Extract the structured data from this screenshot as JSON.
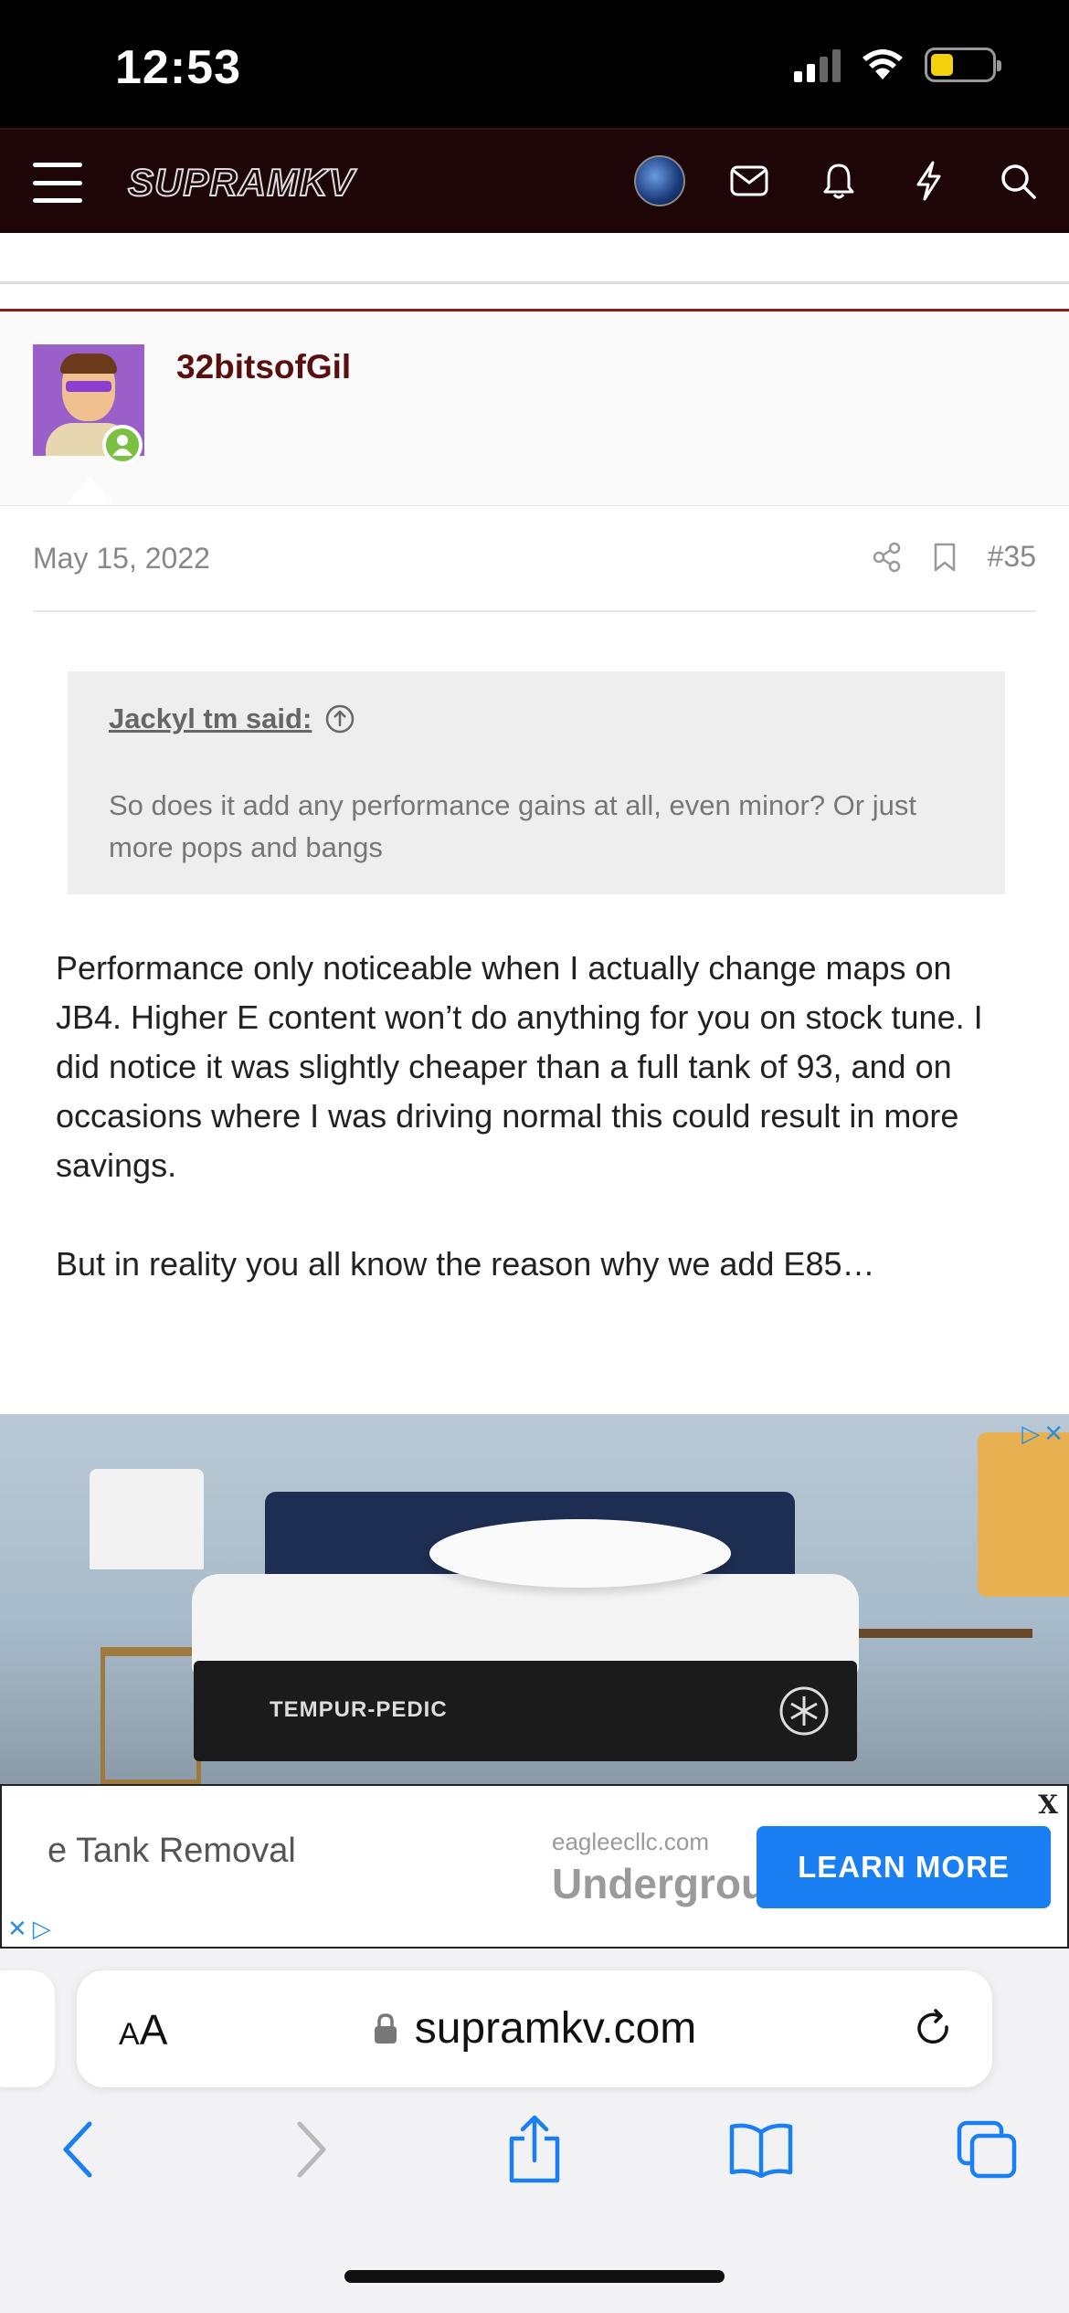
{
  "status_bar": {
    "time": "12:53"
  },
  "header": {
    "logo_text": "SUPRAMKV"
  },
  "post": {
    "username": "32bitsofGil",
    "date": "May 15, 2022",
    "number": "#35",
    "quote_author": "Jackyl tm said:",
    "quote_text": "So does it add any performance gains at all, even minor? Or just more pops and bangs",
    "body_p1": "Performance only noticeable when I actually change maps on JB4. Higher E content won’t do anything for you on stock tune. I did notice it was slightly cheaper than a full tank of 93, and on occasions where I was driving normal this could result in more savings.",
    "body_p2": "But in reality you all know the reason why we add E85…"
  },
  "ad_image": {
    "brand": "TEMPUR-PEDIC"
  },
  "ad_banner": {
    "title": "e Tank Removal",
    "domain": "eagleecllc.com",
    "subtitle": "Undergrou",
    "cta": "LEARN MORE",
    "close": "X"
  },
  "browser": {
    "aa_large": "A",
    "aa_small": "A",
    "url": "supramkv.com"
  },
  "colors": {
    "header_bg": "#1d0508",
    "username": "#5a0f0f",
    "accent_line": "#8b1a1a",
    "cta": "#1a7ff2",
    "ios_blue": "#1a7ff2"
  }
}
